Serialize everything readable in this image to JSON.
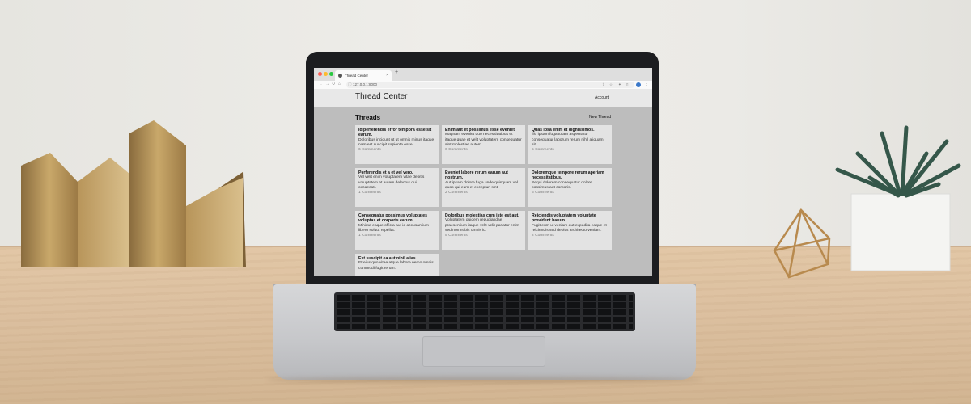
{
  "browser": {
    "tab_title": "Thread Center",
    "tab_close": "×",
    "new_tab": "+",
    "url": "127.0.0.1:8000"
  },
  "app": {
    "title": "Thread Center",
    "account_link": "Account",
    "section_title": "Threads",
    "new_thread_button": "New Thread"
  },
  "threads": [
    {
      "title": "Id perferendis error tempora esse sit earum.",
      "body": "Doloribus incidunt ut ut omnis minus itaque nam est suscipit sapiente esse.",
      "comments": "6 Comments"
    },
    {
      "title": "Enim aut et possimus esse eveniet.",
      "body": "Magnam eveniet quo necessitatibus et itaque quae et velit voluptatem consequatur sint molestiae autem.",
      "comments": "6 Comments"
    },
    {
      "title": "Quas ipsa enim et dignissimos.",
      "body": "Illo ipsam fuga totam aspernatur consequatur laborum rerum nihil aliquam sit.",
      "comments": "5 Comments"
    },
    {
      "title": "Perferendis et a et vel vero.",
      "body": "Vel velit enim voluptatem vitae debitis voluptatem et autem delectus qui occaecati.",
      "comments": "1 Comments"
    },
    {
      "title": "Eveniet labore rerum earum aut nostrum.",
      "body": "Aut ipsam dolore fuga unde quisquam vel quos qui eum et excepturi sint.",
      "comments": "2 Comments"
    },
    {
      "title": "Doloremque tempore rerum aperiam necessitatibus.",
      "body": "Sequi dolorem consequatur dolore possimus aut corporis.",
      "comments": "6 Comments"
    },
    {
      "title": "Consequatur possimus voluptates voluptas et corporis earum.",
      "body": "Minima eaque officia aut id accusantium libero soluta repellat.",
      "comments": "1 Comments"
    },
    {
      "title": "Doloribus molestias cum iste est aut.",
      "body": "Voluptatem quidem repudiandae praesentium itaque velit velit pariatur enim sed non nobis omnis id.",
      "comments": "5 Comments"
    },
    {
      "title": "Reiciendis voluptatem voluptate provident harum.",
      "body": "Fugit eum ut veniam aut expedita eaque et reiciendis sed debitis architecto veniam.",
      "comments": "2 Comments"
    },
    {
      "title": "Est suscipit ea aut nihil alias.",
      "body": "Et eius quo vitae atque labore nemo omnis commodi fugit rerum.",
      "comments": ""
    }
  ],
  "colors": {
    "lid": "#1c1d20",
    "screen_bg": "#bdbdbd",
    "card_bg": "#e3e3e3",
    "wall": "#eceae6",
    "desk": "#dcc0a0"
  },
  "icons": [
    "back-icon",
    "forward-icon",
    "reload-icon",
    "home-icon",
    "lock-icon",
    "share-icon",
    "star-icon",
    "extensions-icon",
    "sidebar-icon",
    "profile-avatar",
    "menu-icon",
    "favicon"
  ]
}
